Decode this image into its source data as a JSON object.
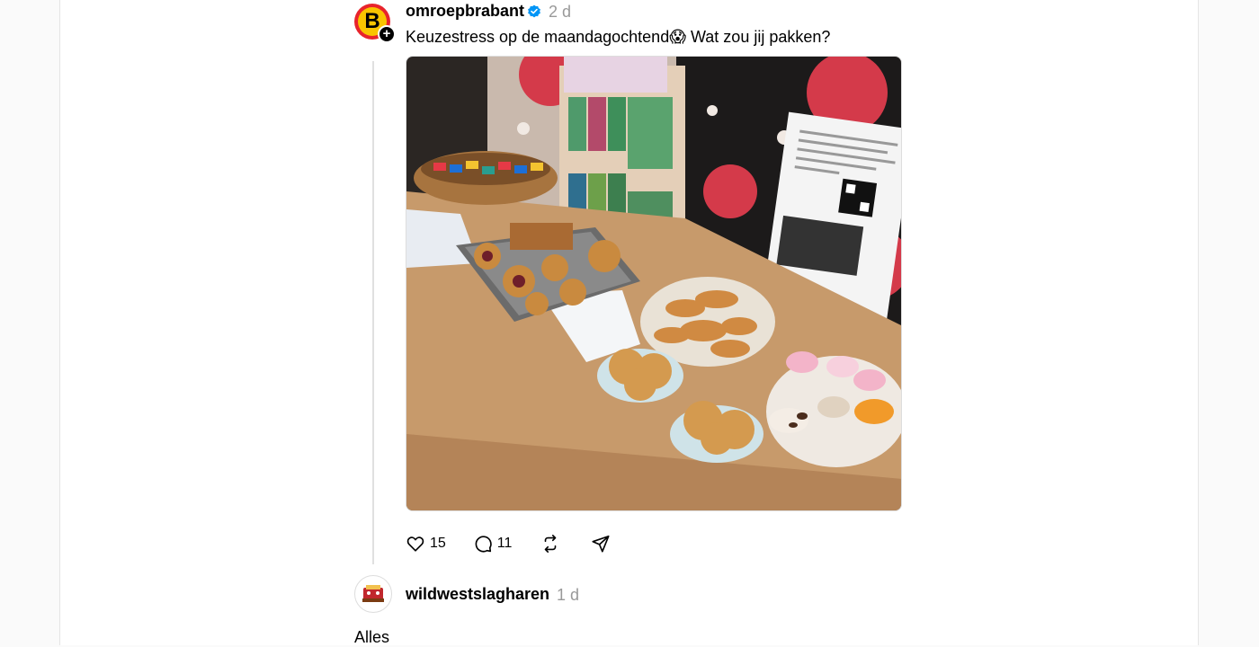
{
  "post": {
    "username": "omroepbrabant",
    "time": "2 d",
    "text": "Keuzestress op de maandagochtend😱 Wat zou jij pakken?",
    "avatar_letter": "B",
    "image_alt": "Tafel met koekjes, gebak, snoep en thee"
  },
  "actions": {
    "likes": "15",
    "comments": "11"
  },
  "reply": {
    "username": "wildwestslagharen",
    "time": "1 d",
    "text": "Alles"
  },
  "colors": {
    "verified": "#0095f6",
    "muted": "#999999",
    "brand_red": "#e8242c",
    "brand_yellow": "#f9c400"
  }
}
